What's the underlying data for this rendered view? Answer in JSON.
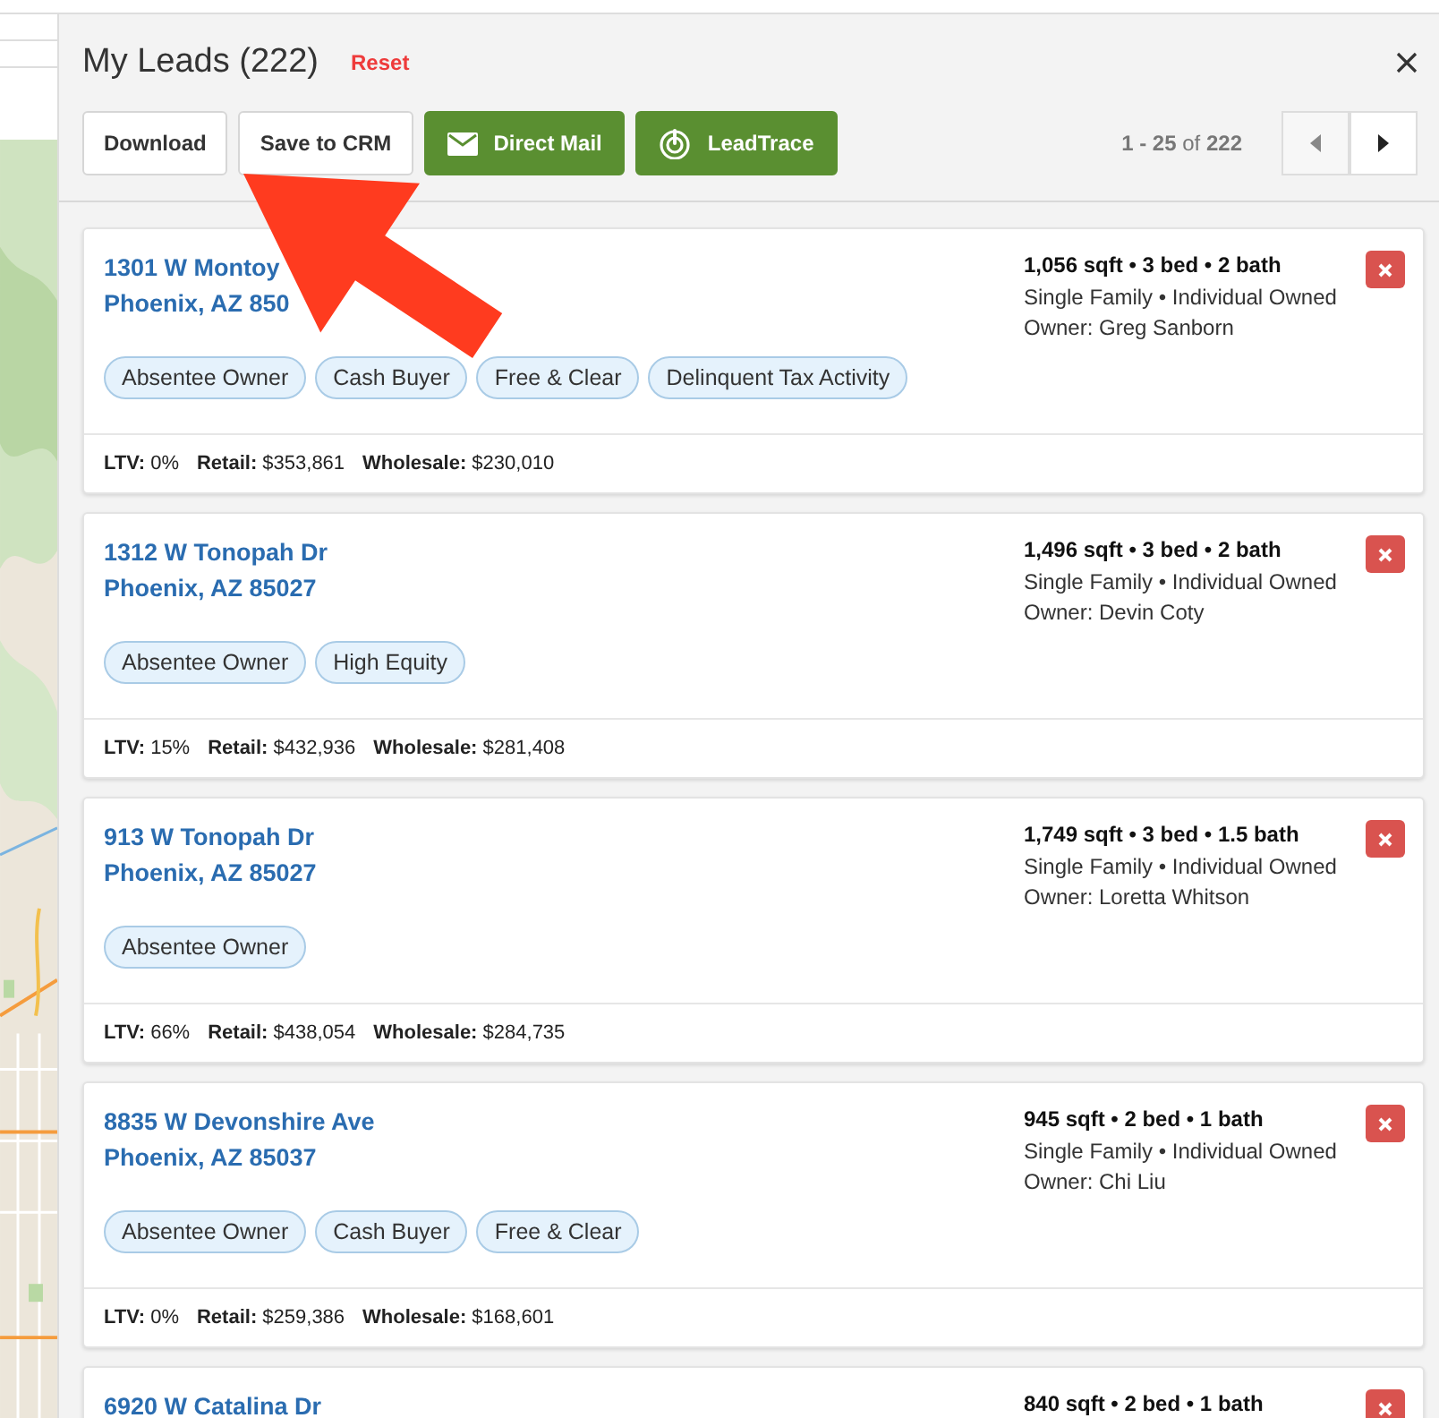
{
  "panel": {
    "title": "My Leads (222)",
    "reset": "Reset"
  },
  "toolbar": {
    "buttons": [
      {
        "label": "Download",
        "kind": "plain"
      },
      {
        "label": "Save to CRM",
        "kind": "plain"
      },
      {
        "label": "Direct Mail",
        "kind": "mail"
      },
      {
        "label": "LeadTrace",
        "kind": "trace"
      }
    ],
    "pagination": {
      "range": "**1 - 25** of **222**",
      "prev_disabled": true,
      "next_disabled": false
    }
  },
  "leads": [
    {
      "address_line1": "1301 W Montoy",
      "address_line2": "Phoenix, AZ 850",
      "specs": "1,056 sqft • 3 bed • 2 bath",
      "type": "Single Family • Individual Owned",
      "owner": "Owner: Greg Sanborn",
      "tags": [
        "Absentee Owner",
        "Cash Buyer",
        "Free & Clear",
        "Delinquent Tax Activity"
      ],
      "footer": [
        "**LTV:** 0%",
        "**Retail:** $353,861",
        "**Wholesale:** $230,010"
      ]
    },
    {
      "address_line1": "1312 W Tonopah Dr",
      "address_line2": "Phoenix, AZ 85027",
      "specs": "1,496 sqft • 3 bed • 2 bath",
      "type": "Single Family • Individual Owned",
      "owner": "Owner: Devin Coty",
      "tags": [
        "Absentee Owner",
        "High Equity"
      ],
      "footer": [
        "**LTV:** 15%",
        "**Retail:** $432,936",
        "**Wholesale:** $281,408"
      ]
    },
    {
      "address_line1": "913 W Tonopah Dr",
      "address_line2": "Phoenix, AZ 85027",
      "specs": "1,749 sqft • 3 bed • 1.5 bath",
      "type": "Single Family • Individual Owned",
      "owner": "Owner: Loretta Whitson",
      "tags": [
        "Absentee Owner"
      ],
      "footer": [
        "**LTV:** 66%",
        "**Retail:** $438,054",
        "**Wholesale:** $284,735"
      ]
    },
    {
      "address_line1": "8835 W Devonshire Ave",
      "address_line2": "Phoenix, AZ 85037",
      "specs": "945 sqft • 2 bed • 1 bath",
      "type": "Single Family • Individual Owned",
      "owner": "Owner: Chi Liu",
      "tags": [
        "Absentee Owner",
        "Cash Buyer",
        "Free & Clear"
      ],
      "footer": [
        "**LTV:** 0%",
        "**Retail:** $259,386",
        "**Wholesale:** $168,601"
      ]
    },
    {
      "address_line1": "6920 W Catalina Dr",
      "specs": "840 sqft • 2 bed • 1 bath"
    }
  ]
}
